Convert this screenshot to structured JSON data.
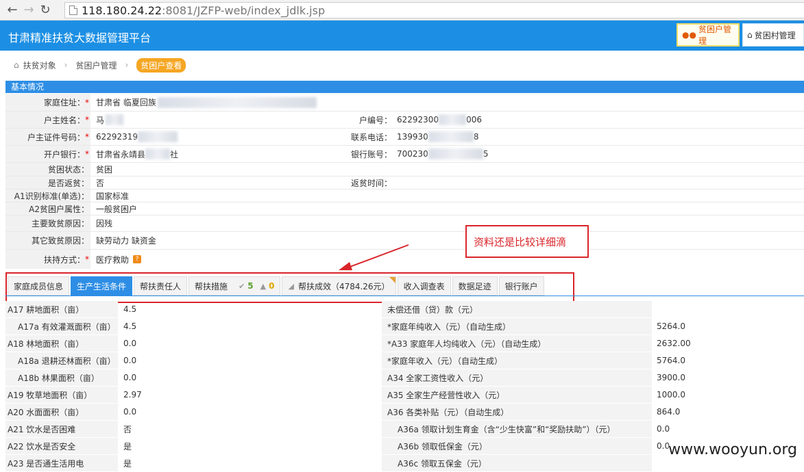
{
  "browser": {
    "url_host": "118.180.24.22",
    "url_rest": ":8081/JZFP-web/index_jdlk.jsp"
  },
  "header": {
    "title": "甘肃精准扶贫大数据管理平台",
    "btn_household": "贫困户管理",
    "btn_village": "贫困村管理"
  },
  "breadcrumb": {
    "item1": "扶贫对象",
    "item2": "贫困户管理",
    "current": "贫困户查看"
  },
  "basic": {
    "section_title": "基本情况",
    "address_label": "家庭住址：",
    "address_value": "甘肃省  临夏回族",
    "head_name_label": "户主姓名：",
    "head_name_value": "马",
    "household_no_label": "户编号：",
    "household_no_value_a": "62292300",
    "household_no_value_b": "006",
    "id_label": "户主证件号码：",
    "id_value": "62292319",
    "phone_label": "联系电话：",
    "phone_value_a": "139930",
    "phone_value_b": "8",
    "bank_label": "开户银行：",
    "bank_value_a": "甘肃省永靖县",
    "bank_value_b": "社",
    "account_label": "银行账号：",
    "account_value_a": "700230",
    "account_value_b": "5",
    "status_label": "贫困状态：",
    "status_value": "贫困",
    "return_label": "是否返贫：",
    "return_value": "否",
    "return_time_label": "返贫时间：",
    "return_time_value": "",
    "a1_label": "A1识别标准(单选)：",
    "a1_value": "国家标准",
    "a2_label": "A2贫困户属性：",
    "a2_value": "一般贫困户",
    "main_reason_label": "主要致贫原因：",
    "main_reason_value": "因残",
    "other_reason_label": "其它致贫原因：",
    "other_reason_value": "缺劳动力  缺资金",
    "support_label": "扶持方式：",
    "support_value": "医疗救助",
    "required_mark": "*"
  },
  "annotation": {
    "text": "资料还是比较详细滴"
  },
  "tabs": {
    "family": "家庭成员信息",
    "production": "生产生活条件",
    "responsible": "帮扶责任人",
    "measures": "帮扶措施",
    "measures_ok": "5",
    "measures_warn": "0",
    "result": "帮扶成效（4784.26元）",
    "survey": "收入调查表",
    "footprint": "数据足迹",
    "bank": "银行账户"
  },
  "details": [
    {
      "l": "A17 耕地面积（亩）",
      "v": "4.5",
      "l2": "未偿还借（贷）款（元）",
      "v2": "",
      "ind": false,
      "ind2": false
    },
    {
      "l": "A17a 有效灌溉面积（亩）",
      "v": "4.5",
      "l2": "*家庭年纯收入（元）（自动生成）",
      "v2": "5264.0",
      "ind": true,
      "ind2": false
    },
    {
      "l": "A18 林地面积（亩）",
      "v": "0.0",
      "l2": "*A33 家庭年人均纯收入（元）（自动生成）",
      "v2": "2632.00",
      "ind": false,
      "ind2": false
    },
    {
      "l": "A18a 退耕还林面积（亩）",
      "v": "0.0",
      "l2": "*家庭年收入（元）（自动生成）",
      "v2": "5764.0",
      "ind": true,
      "ind2": false
    },
    {
      "l": "A18b 林果面积（亩）",
      "v": "0.0",
      "l2": "A34 全家工资性收入（元）",
      "v2": "3900.0",
      "ind": true,
      "ind2": false
    },
    {
      "l": "A19 牧草地面积（亩）",
      "v": "2.97",
      "l2": "A35 全家生产经营性收入（元）",
      "v2": "1000.0",
      "ind": false,
      "ind2": false
    },
    {
      "l": "A20 水面面积（亩）",
      "v": "0.0",
      "l2": "A36 各类补贴（元）（自动生成）",
      "v2": "864.0",
      "ind": false,
      "ind2": false
    },
    {
      "l": "A21 饮水是否困难",
      "v": "否",
      "l2": "A36a 领取计划生育金（含“少生快富”和“奖励扶助”）（元）",
      "v2": "0.0",
      "ind": false,
      "ind2": true
    },
    {
      "l": "A22 饮水是否安全",
      "v": "是",
      "l2": "A36b 领取低保金（元）",
      "v2": "0.0",
      "ind": false,
      "ind2": true
    },
    {
      "l": "A23 是否通生活用电",
      "v": "是",
      "l2": "A36c 领取五保金（元）",
      "v2": "",
      "ind": false,
      "ind2": true
    }
  ],
  "watermark": "www.wooyun.org"
}
